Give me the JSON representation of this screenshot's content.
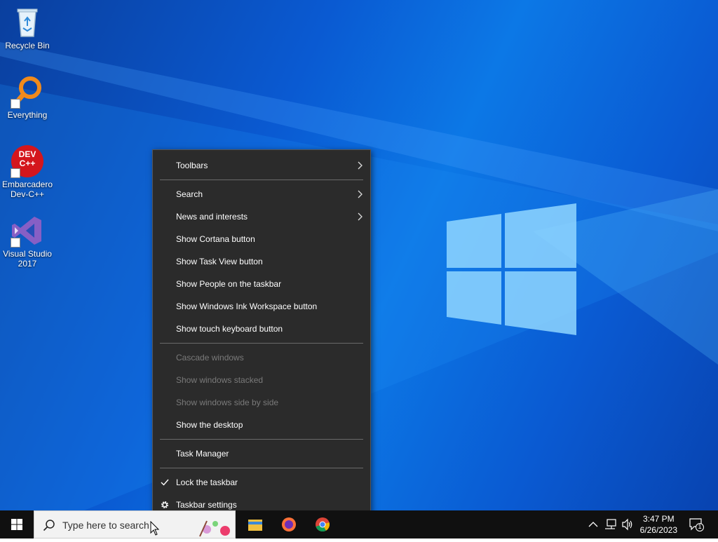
{
  "desktop": {
    "icons": [
      {
        "label": "Recycle Bin"
      },
      {
        "label": "Everything"
      },
      {
        "label": "Embarcadero Dev-C++",
        "glyph_text": "DEV C++"
      },
      {
        "label": "Visual Studio 2017"
      }
    ]
  },
  "context_menu": {
    "items": [
      {
        "label": "Toolbars",
        "submenu": true
      },
      {
        "label": "Search",
        "submenu": true
      },
      {
        "label": "News and interests",
        "submenu": true
      },
      {
        "label": "Show Cortana button"
      },
      {
        "label": "Show Task View button"
      },
      {
        "label": "Show People on the taskbar"
      },
      {
        "label": "Show Windows Ink Workspace button"
      },
      {
        "label": "Show touch keyboard button"
      },
      {
        "label": "Cascade windows",
        "disabled": true
      },
      {
        "label": "Show windows stacked",
        "disabled": true
      },
      {
        "label": "Show windows side by side",
        "disabled": true
      },
      {
        "label": "Show the desktop"
      },
      {
        "label": "Task Manager"
      },
      {
        "label": "Lock the taskbar",
        "checked": true
      },
      {
        "label": "Taskbar settings",
        "icon": "gear-icon"
      }
    ]
  },
  "taskbar": {
    "search_placeholder": "Type here to search",
    "clock": {
      "time": "3:47 PM",
      "date": "6/26/2023"
    },
    "notification_count": "1"
  },
  "colors": {
    "menu_bg": "#2b2b2b",
    "menu_disabled": "#7a7a7a",
    "taskbar_bg": "#101010",
    "desktop_accent": "#0c78e6"
  }
}
